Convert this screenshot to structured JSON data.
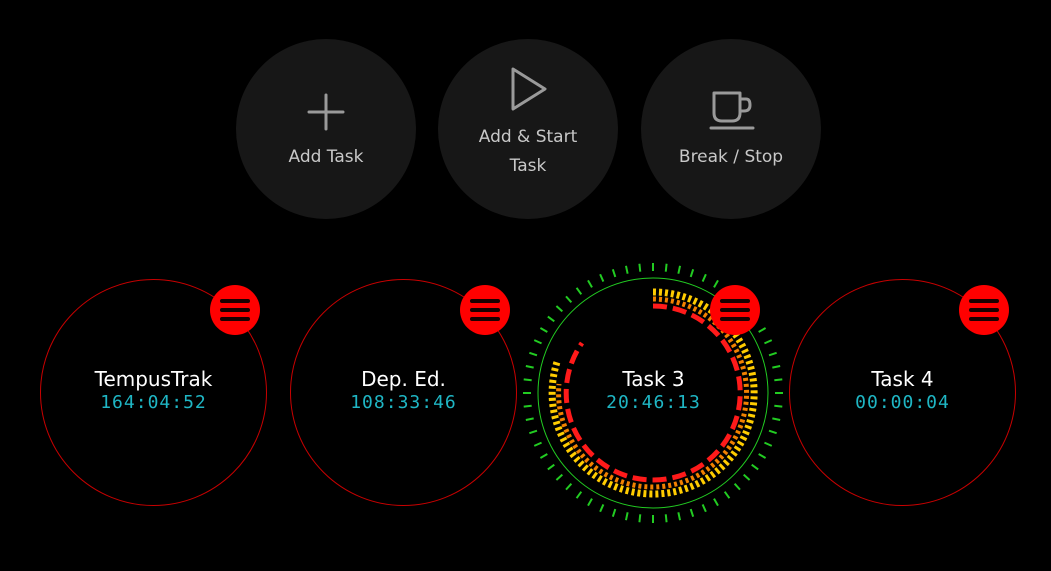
{
  "actions": {
    "add_task": {
      "label": "Add Task",
      "icon": "plus-icon"
    },
    "add_start_task": {
      "label": "Add & Start Task",
      "icon": "play-icon"
    },
    "break_stop": {
      "label": "Break / Stop",
      "icon": "coffee-cup-icon"
    }
  },
  "tasks": [
    {
      "name": "TempusTrak",
      "time": "164:04:52",
      "active": false
    },
    {
      "name": "Dep. Ed.",
      "time": "108:33:46",
      "active": false
    },
    {
      "name": "Task 3",
      "time": "20:46:13",
      "active": true
    },
    {
      "name": "Task 4",
      "time": "00:00:04",
      "active": false
    }
  ],
  "colors": {
    "accent_red": "#ff0000",
    "task_border": "#c80000",
    "timer_text": "#1fb6c4",
    "button_bg": "#171717",
    "tick_green": "#22cc22",
    "progress_yellow": "#ffcc00",
    "progress_orange": "#ff8800"
  }
}
